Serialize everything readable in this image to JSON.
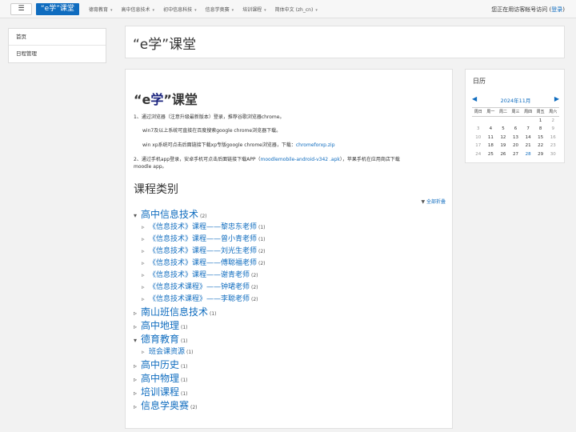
{
  "navbar": {
    "brand": "“e学”课堂",
    "menu": [
      "德育教育",
      "高中信息技术",
      "初中信息科技",
      "信息学奥赛",
      "培训课程",
      "简体中文 (zh_cn)"
    ],
    "login_prefix": "您正在用访客帐号访问 (",
    "login_link": "登录",
    "login_suffix": ")"
  },
  "sidebar": {
    "items": [
      "首页",
      "日程管理"
    ]
  },
  "header": {
    "title": "“e学”课堂"
  },
  "main": {
    "title_pre": "“e",
    "title_mid": "学",
    "title_post": "”课堂",
    "p1": "1、通过浏览器（注意升级最新版本）登录，推荐谷歌浏览器chrome。",
    "p2": "win7及以上系统可直接在百度搜索google chrome浏览器下载。",
    "p3_text": "win xp系统可点击后面链接下载xp专版google chrome浏览器，下载：",
    "p3_link": "chromeforxp.zip",
    "p4_text": "2、通过手机app登录，安卓手机可点击后面链接下载APP（",
    "p4_link": "moodlemobile-android-v342 .apk",
    "p4_rest": "），苹果手机在应用商店下载",
    "p4_line2": "moodle app。",
    "categories_title": "课程类别",
    "collapse_all": "全部折叠",
    "tree": [
      {
        "label": "高中信息技术",
        "count": "(2)",
        "level": 1,
        "expanded": true
      },
      {
        "label": "《信息技术》课程——黎忠东老师",
        "count": "(1)",
        "level": 2
      },
      {
        "label": "《信息技术》课程——曾小青老师",
        "count": "(1)",
        "level": 2
      },
      {
        "label": "《信息技术》课程——刘光生老师",
        "count": "(2)",
        "level": 2
      },
      {
        "label": "《信息技术》课程——傅聪福老师",
        "count": "(2)",
        "level": 2
      },
      {
        "label": "《信息技术》课程——谢青老师",
        "count": "(2)",
        "level": 2
      },
      {
        "label": "《信息技术课程》——钟珺老师",
        "count": "(2)",
        "level": 2
      },
      {
        "label": "《信息技术课程》——李聪老师",
        "count": "(2)",
        "level": 2
      },
      {
        "label": "南山班信息技术",
        "count": "(1)",
        "level": 1,
        "expanded": false
      },
      {
        "label": "高中地理",
        "count": "(1)",
        "level": 1,
        "expanded": false
      },
      {
        "label": "德育教育",
        "count": "(1)",
        "level": 1,
        "expanded": true
      },
      {
        "label": "班会课资源",
        "count": "(1)",
        "level": 2
      },
      {
        "label": "高中历史",
        "count": "(1)",
        "level": 1,
        "expanded": false
      },
      {
        "label": "高中物理",
        "count": "(1)",
        "level": 1,
        "expanded": false
      },
      {
        "label": "培训课程",
        "count": "(1)",
        "level": 1,
        "expanded": false
      },
      {
        "label": "信息学奥赛",
        "count": "(2)",
        "level": 1,
        "expanded": false
      }
    ]
  },
  "calendar": {
    "title": "日历",
    "month": "2024年11月",
    "weekdays": [
      "周日",
      "周一",
      "周二",
      "周三",
      "周四",
      "周五",
      "周六"
    ],
    "weeks": [
      [
        "",
        "",
        "",
        "",
        "",
        "1",
        "2"
      ],
      [
        "3",
        "4",
        "5",
        "6",
        "7",
        "8",
        "9"
      ],
      [
        "10",
        "11",
        "12",
        "13",
        "14",
        "15",
        "16"
      ],
      [
        "17",
        "18",
        "19",
        "20",
        "21",
        "22",
        "23"
      ],
      [
        "24",
        "25",
        "26",
        "27",
        "28",
        "29",
        "30"
      ]
    ],
    "today": "28"
  }
}
